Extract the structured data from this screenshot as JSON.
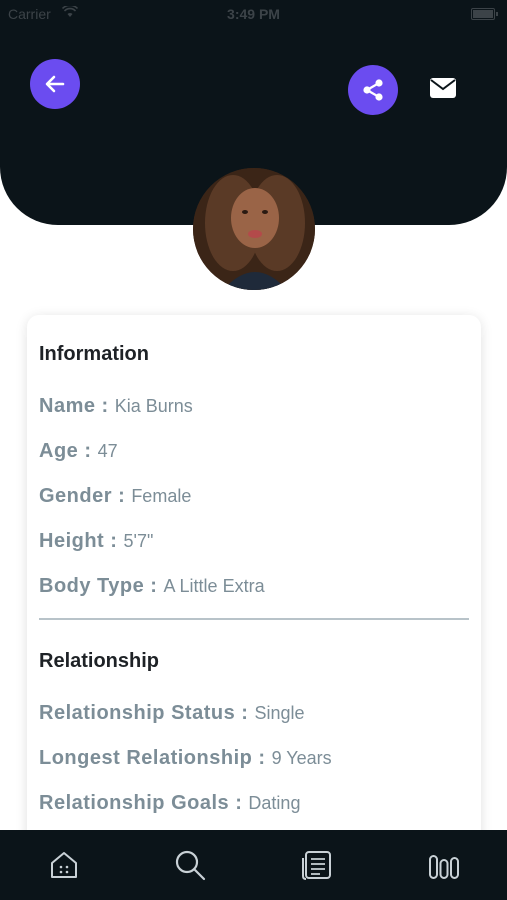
{
  "status": {
    "carrier": "Carrier",
    "time": "3:49 PM"
  },
  "header": {
    "colors": {
      "header_bg": "#0b1419",
      "accent": "#6b4cf0"
    }
  },
  "profile": {
    "information": {
      "title": "Information",
      "rows": [
        {
          "label": "Name :",
          "value": "Kia Burns"
        },
        {
          "label": "Age :",
          "value": "47"
        },
        {
          "label": "Gender :",
          "value": "Female"
        },
        {
          "label": "Height :",
          "value": "5'7\""
        },
        {
          "label": "Body Type :",
          "value": "A Little Extra"
        }
      ]
    },
    "relationship": {
      "title": "Relationship",
      "rows": [
        {
          "label": "Relationship Status :",
          "value": "Single"
        },
        {
          "label": "Longest Relationship :",
          "value": "9 Years"
        },
        {
          "label": "Relationship Goals :",
          "value": "Dating"
        }
      ]
    }
  },
  "tabs": [
    "home-icon",
    "search-icon",
    "feed-icon",
    "stats-icon"
  ]
}
